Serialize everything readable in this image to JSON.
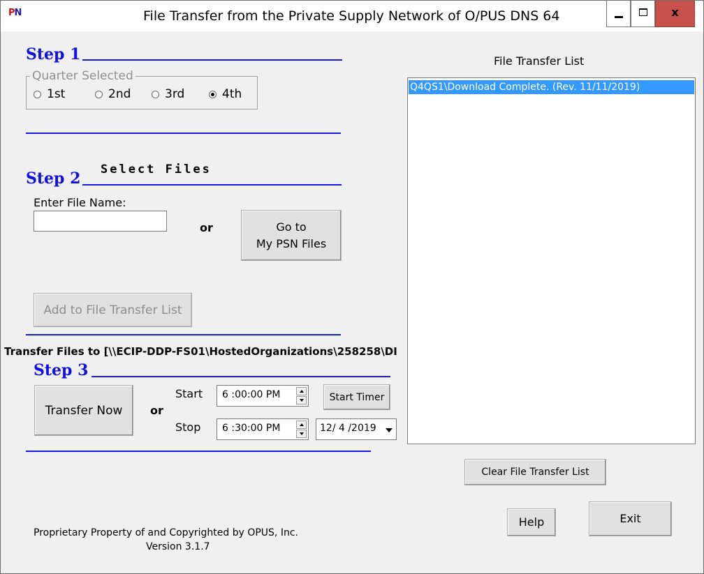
{
  "window": {
    "title": "File Transfer from the Private Supply Network of O/PUS DNS 64",
    "icon_left": "P",
    "icon_right": "N",
    "controls": [
      "minimize-icon",
      "maximize-icon",
      "close-icon"
    ],
    "close_label": "x"
  },
  "step1": {
    "label": "Step 1",
    "group_label": "Quarter Selected",
    "options": [
      "1st",
      "2nd",
      "3rd",
      "4th"
    ],
    "selected": "4th"
  },
  "step2": {
    "label": "Step 2",
    "heading": "Select Files",
    "file_name_label": "Enter File Name:",
    "file_name_value": "",
    "or_text": "or",
    "go_to_line1": "Go to",
    "go_to_line2": "My PSN Files",
    "add_button": "Add to File Transfer List"
  },
  "transfer_to": "Transfer Files to [\\\\ECIP-DDP-FS01\\HostedOrganizations\\258258\\DI",
  "step3": {
    "label": "Step 3",
    "transfer_now": "Transfer Now",
    "or_text": "or",
    "start_label": "Start",
    "stop_label": "Stop",
    "start_time": "6 :00:00 PM",
    "stop_time": "6 :30:00 PM",
    "start_timer": "Start Timer",
    "date": "12/ 4 /2019"
  },
  "file_list": {
    "title": "File Transfer List",
    "items": [
      "Q4QS1\\Download Complete. (Rev. 11/11/2019)"
    ],
    "clear_button": "Clear File Transfer List"
  },
  "buttons": {
    "help": "Help",
    "exit": "Exit"
  },
  "footer": {
    "copyright": "Proprietary Property of and Copyrighted by OPUS, Inc.",
    "version": "Version 3.1.7"
  },
  "colors": {
    "step_blue": "#1010e0",
    "selection": "#3399ff",
    "close_button": "#c8504a"
  }
}
